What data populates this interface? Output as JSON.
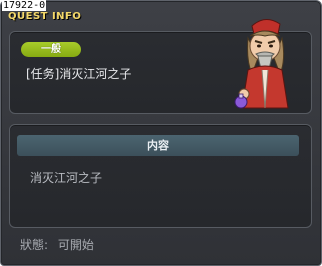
{
  "quest_id": "17922-0",
  "window_title": "QUEST INFO",
  "category": "一般",
  "quest_name": "[任务]消灭江河之子",
  "content_header": "内容",
  "content_text": "消灭江河之子",
  "status": {
    "label": "狀態:",
    "value": "可開始"
  },
  "colors": {
    "window_bg": "#36383d",
    "title": "#f4d86a",
    "category_tag": "#96bb1c",
    "content_header": "#44606c"
  }
}
